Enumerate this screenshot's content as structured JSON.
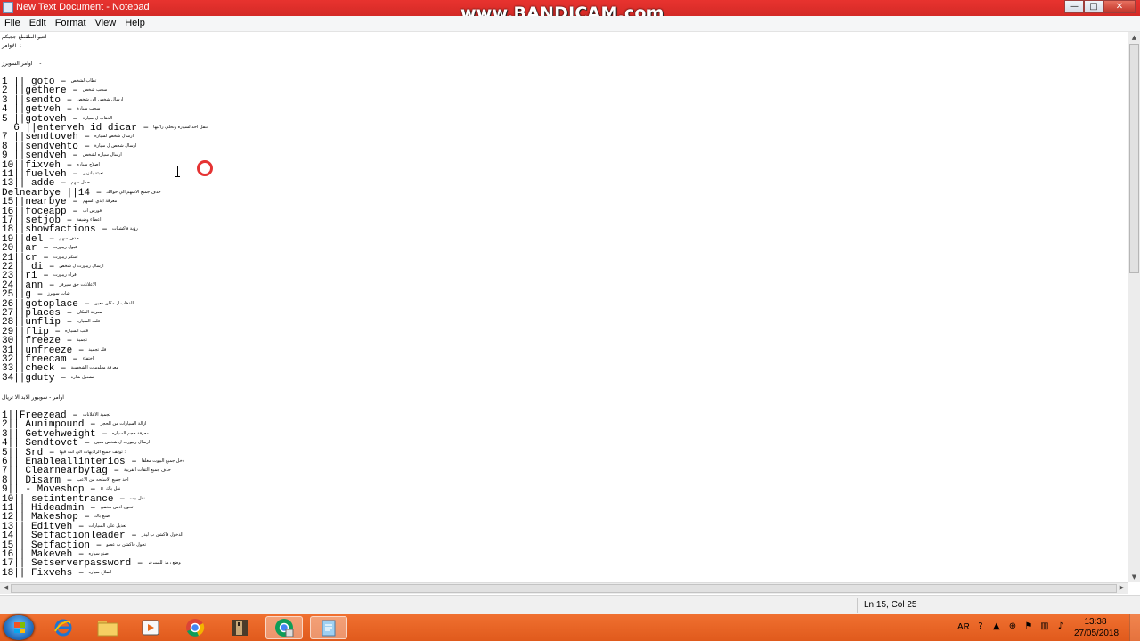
{
  "window": {
    "title": "New Text Document - Notepad",
    "watermark": "www.BANDICAM.com",
    "controls": {
      "minimize": "—",
      "maximize": "□",
      "close": "✕"
    }
  },
  "menu": [
    "File",
    "Edit",
    "Format",
    "View",
    "Help"
  ],
  "editor": {
    "intro": [
      "انتبو الطقطع ججبكم",
      "الاوامر  :",
      "اوامر السوبرز  : -"
    ],
    "section1": [
      {
        "num": "1",
        "pre": " || ",
        "cmd": "goto",
        "ar": "تطاب لشخص"
      },
      {
        "num": "2",
        "pre": " ||",
        "cmd": "gethere",
        "ar": "سحب شخص"
      },
      {
        "num": "3",
        "pre": " ||",
        "cmd": "sendto",
        "ar": "ارسال شخص الى شخص"
      },
      {
        "num": "4",
        "pre": " ||",
        "cmd": "getveh",
        "ar": "سحب سيارة"
      },
      {
        "num": "5",
        "pre": " ||",
        "cmd": "gotoveh",
        "ar": "الذهاب ل سيارة"
      },
      {
        "num": "  6",
        "pre": " ||",
        "cmd": "enterveh id dicar",
        "ar": "تنقل احد لسيارة وتخلي راكبها"
      },
      {
        "num": "7",
        "pre": " ||",
        "cmd": "sendtoveh",
        "ar": "ارسال شخص لسياره"
      },
      {
        "num": "8",
        "pre": " ||",
        "cmd": "sendvehto",
        "ar": "ارسال شخص ل سيارة"
      },
      {
        "num": "9",
        "pre": " ||",
        "cmd": "sendveh",
        "ar": "ارسال سياره لشخص"
      },
      {
        "num": "10",
        "pre": "||",
        "cmd": "fixveh",
        "ar": "اصلاح سياره"
      },
      {
        "num": "11",
        "pre": "||",
        "cmd": "fuelveh",
        "ar": "تعبئة بانزين"
      },
      {
        "num": "13",
        "pre": "||",
        "cmd": " adde",
        "ar": "حمل سهم"
      },
      {
        "num": "Del",
        "pre": "",
        "cmd": "nearbye ||14",
        "ar": "حذف جميع الاسهم الي حوالك"
      },
      {
        "num": "15",
        "pre": "||",
        "cmd": "nearbye",
        "ar": "معرفة ايدي السهم"
      },
      {
        "num": "16",
        "pre": "||",
        "cmd": "foceapp",
        "ar": "فورس اب"
      },
      {
        "num": "17",
        "pre": "||",
        "cmd": "setjob",
        "ar": "اعطاء وضيفة"
      },
      {
        "num": "18",
        "pre": "||",
        "cmd": "showfactions",
        "ar": "رؤية فاكشنات"
      },
      {
        "num": "19",
        "pre": "||",
        "cmd": "del",
        "ar": "حذف سهم"
      },
      {
        "num": "20",
        "pre": "||",
        "cmd": "ar",
        "ar": "قبول ريبورت"
      },
      {
        "num": "21",
        "pre": "||",
        "cmd": "cr",
        "ar": "اسكر ريبورت"
      },
      {
        "num": "22",
        "pre": "||",
        "cmd": " di",
        "ar": "ارسال ريبورت ل شخص"
      },
      {
        "num": "23",
        "pre": "||",
        "cmd": "ri",
        "ar": "قراة ريبورت"
      },
      {
        "num": "24",
        "pre": "||",
        "cmd": "ann",
        "ar": "الاعلانات حق سيرفر"
      },
      {
        "num": "25",
        "pre": "||",
        "cmd": "g",
        "ar": "شات سوبرز"
      },
      {
        "num": "26",
        "pre": "||",
        "cmd": "gotoplace",
        "ar": "الذهاب ل مكان معين"
      },
      {
        "num": "27",
        "pre": "||",
        "cmd": "places",
        "ar": "معرفة المكان"
      },
      {
        "num": "28",
        "pre": "||",
        "cmd": "unflip",
        "ar": "قلب السياره"
      },
      {
        "num": "29",
        "pre": "||",
        "cmd": "flip",
        "ar": "قلب السياره"
      },
      {
        "num": "30",
        "pre": "||",
        "cmd": "freeze",
        "ar": "تجميد"
      },
      {
        "num": "31",
        "pre": "||",
        "cmd": "unfreeze",
        "ar": "فك تجميد"
      },
      {
        "num": "32",
        "pre": "||",
        "cmd": "freecam",
        "ar": "اختفاء"
      },
      {
        "num": "33",
        "pre": "||",
        "cmd": "check",
        "ar": "معرفة معلومات الشخصية"
      },
      {
        "num": "34",
        "pre": "||",
        "cmd": "gduty",
        "ar": "تشغيل شارة"
      }
    ],
    "section2_header": "اوامر - سوبيور الابد الا تريال",
    "section2": [
      {
        "num": "1",
        "pre": "||",
        "cmd": "Freezead",
        "ar": "تجميد الاعلانات"
      },
      {
        "num": "2",
        "pre": "|| ",
        "cmd": "Aunimpound",
        "ar": "ازالة السيارات من الحجز"
      },
      {
        "num": "3",
        "pre": "|| ",
        "cmd": "Getvehweight",
        "ar": "معرفة حجم السياره"
      },
      {
        "num": "4",
        "pre": "|| ",
        "cmd": "Sendtovct",
        "ar": "ارسال ريبورت ل شخص معين"
      },
      {
        "num": "5",
        "pre": "|| ",
        "cmd": "Srd",
        "ar": "توقف جميع الراديهات الي انت فيها :"
      },
      {
        "num": "6",
        "pre": "|| ",
        "cmd": "Enableallinterios",
        "ar": "دخل جميع البيوت مغلقا"
      },
      {
        "num": "7",
        "pre": "|| ",
        "cmd": "Clearnearbytag",
        "ar": "حذف جميع التقات القريبة"
      },
      {
        "num": "8",
        "pre": "|| ",
        "cmd": "Disarm",
        "ar": "اخذ جميع الاسلحه من الاعب"
      },
      {
        "num": "9",
        "pre": "|| - ",
        "cmd": "Moveshop",
        "ar": "u  نقل باك"
      },
      {
        "num": "10",
        "pre": "|| ",
        "cmd": "setintentrance",
        "ar": "نقل بيت"
      },
      {
        "num": "11",
        "pre": "|| ",
        "cmd": "Hideadmin",
        "ar": "تحول ادمن مخفي"
      },
      {
        "num": "12",
        "pre": "|| ",
        "cmd": "Makeshop",
        "ar": "صنع باك"
      },
      {
        "num": "13",
        "pre": "|| ",
        "cmd": "Editveh",
        "ar": "تعديل على السيارات"
      },
      {
        "num": "14",
        "pre": "|| ",
        "cmd": "Setfactionleader",
        "ar": "الدخول فاكشن ب ليدر"
      },
      {
        "num": "15",
        "pre": "|| ",
        "cmd": "Setfaction",
        "ar": "تحول فاكشن ب عضو"
      },
      {
        "num": "16",
        "pre": "|| ",
        "cmd": "Makeveh",
        "ar": "صنع سياره"
      },
      {
        "num": "17",
        "pre": "|| ",
        "cmd": "Setserverpassword",
        "ar": "وضع رمز للسيرفر"
      },
      {
        "num": "18",
        "pre": "|| ",
        "cmd": "Fixvehs",
        "ar": "اصلاح سياره"
      }
    ]
  },
  "status": {
    "position": "Ln 15, Col 25"
  },
  "taskbar": {
    "lang": "AR",
    "time": "13:38",
    "date": "27/05/2018",
    "apps": [
      "internet-explorer-icon",
      "folder-icon",
      "media-player-icon",
      "chrome-icon",
      "game-icon",
      "chrome-alt-icon",
      "notepad-icon"
    ]
  }
}
